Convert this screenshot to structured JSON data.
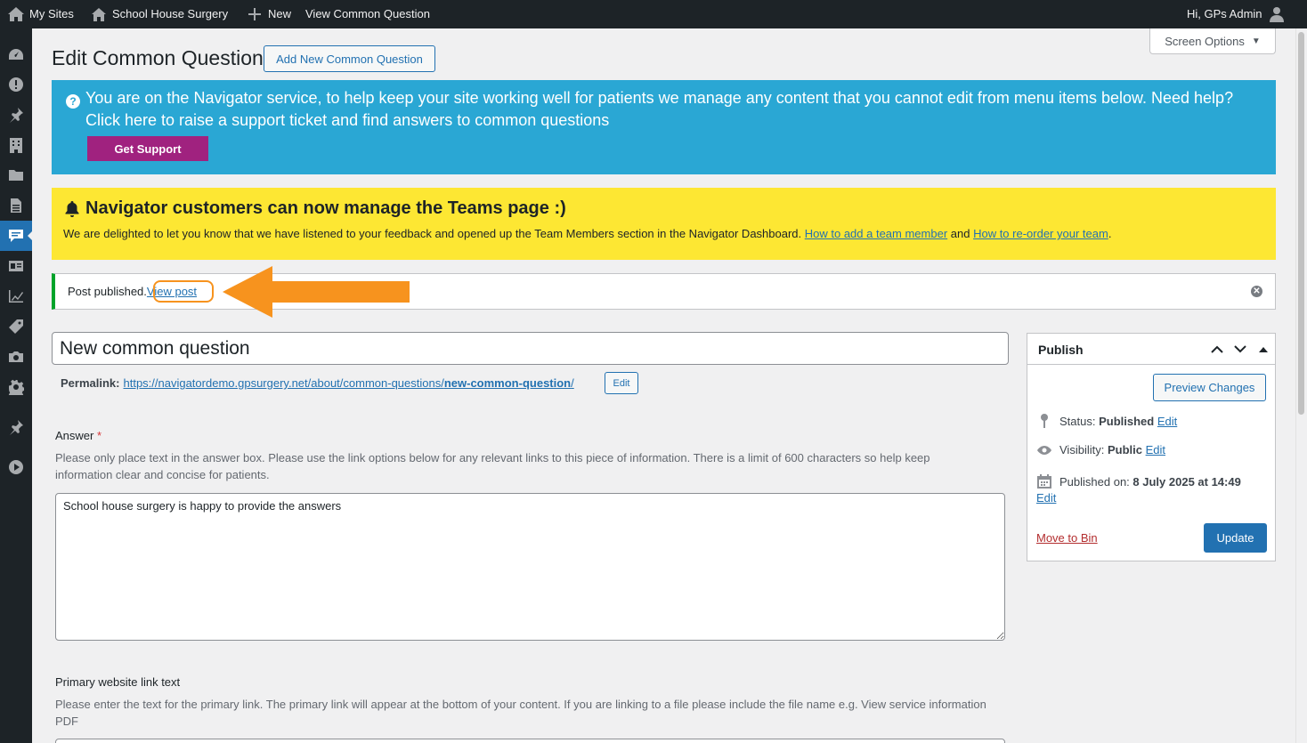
{
  "adminbar": {
    "my_sites": "My Sites",
    "site_name": "School House Surgery",
    "new": "New",
    "view_item": "View Common Question",
    "greeting": "Hi, GPs Admin"
  },
  "sidemenu": {
    "icons": [
      "dashboard-icon",
      "alert-icon",
      "pin-icon",
      "building-icon",
      "folder-icon",
      "page-icon",
      "comments-icon",
      "id-card-icon",
      "chart-icon",
      "tag-icon",
      "camera-icon",
      "settings-icon",
      "pin-icon",
      "play-icon"
    ],
    "current": "comments-icon"
  },
  "header": {
    "page_title": "Edit Common Question",
    "add_new_label": "Add New Common Question",
    "screen_options": "Screen Options"
  },
  "support_notice": {
    "text": "You are on the Navigator service, to help keep your site working well for patients we manage any content that you cannot edit from menu items below. Need help? Click here to raise a support ticket and find answers to common questions",
    "button": "Get Support"
  },
  "teams_notice": {
    "heading": "Navigator customers can now manage the Teams page :)",
    "body_before": "We are delighted to let you know that we have listened to your feedback and opened up the Team Members section in the Navigator Dashboard. ",
    "link1": "How to add a team member",
    "middle": " and ",
    "link2": "How to re-order your team",
    "body_after": "."
  },
  "published_notice": {
    "text": "Post published.",
    "link": "View post"
  },
  "post": {
    "title": "New common question",
    "permalink_label": "Permalink:",
    "permalink_base": "https://navigatordemo.gpsurgery.net/about/common-questions/",
    "permalink_slug": "new-common-question",
    "permalink_trailing": "/",
    "permalink_edit": "Edit"
  },
  "answer": {
    "label": "Answer",
    "required_mark": "*",
    "description": "Please only place text in the answer box. Please use the link options below for any relevant links to this piece of information. There is a limit of 600 characters so help keep information clear and concise for patients.",
    "value": "School house surgery is happy to provide the answers"
  },
  "primary_link": {
    "label": "Primary website link text",
    "description": "Please enter the text for the primary link. The primary link will appear at the bottom of your content. If you are linking to a file please include the file name e.g. View service information PDF"
  },
  "publish": {
    "title": "Publish",
    "preview": "Preview Changes",
    "status_label": "Status:",
    "status_value": "Published",
    "visibility_label": "Visibility:",
    "visibility_value": "Public",
    "published_on_label": "Published on:",
    "published_on_value": "8 July 2025 at 14:49",
    "edit": "Edit",
    "move_to_bin": "Move to Bin",
    "update": "Update"
  },
  "colors": {
    "wp_blue": "#2271b1",
    "support_bg": "#2aa7d4",
    "support_button": "#a0227f",
    "teams_bg": "#fde733",
    "success_green": "#00a32a",
    "annotation_orange": "#f7931e"
  }
}
